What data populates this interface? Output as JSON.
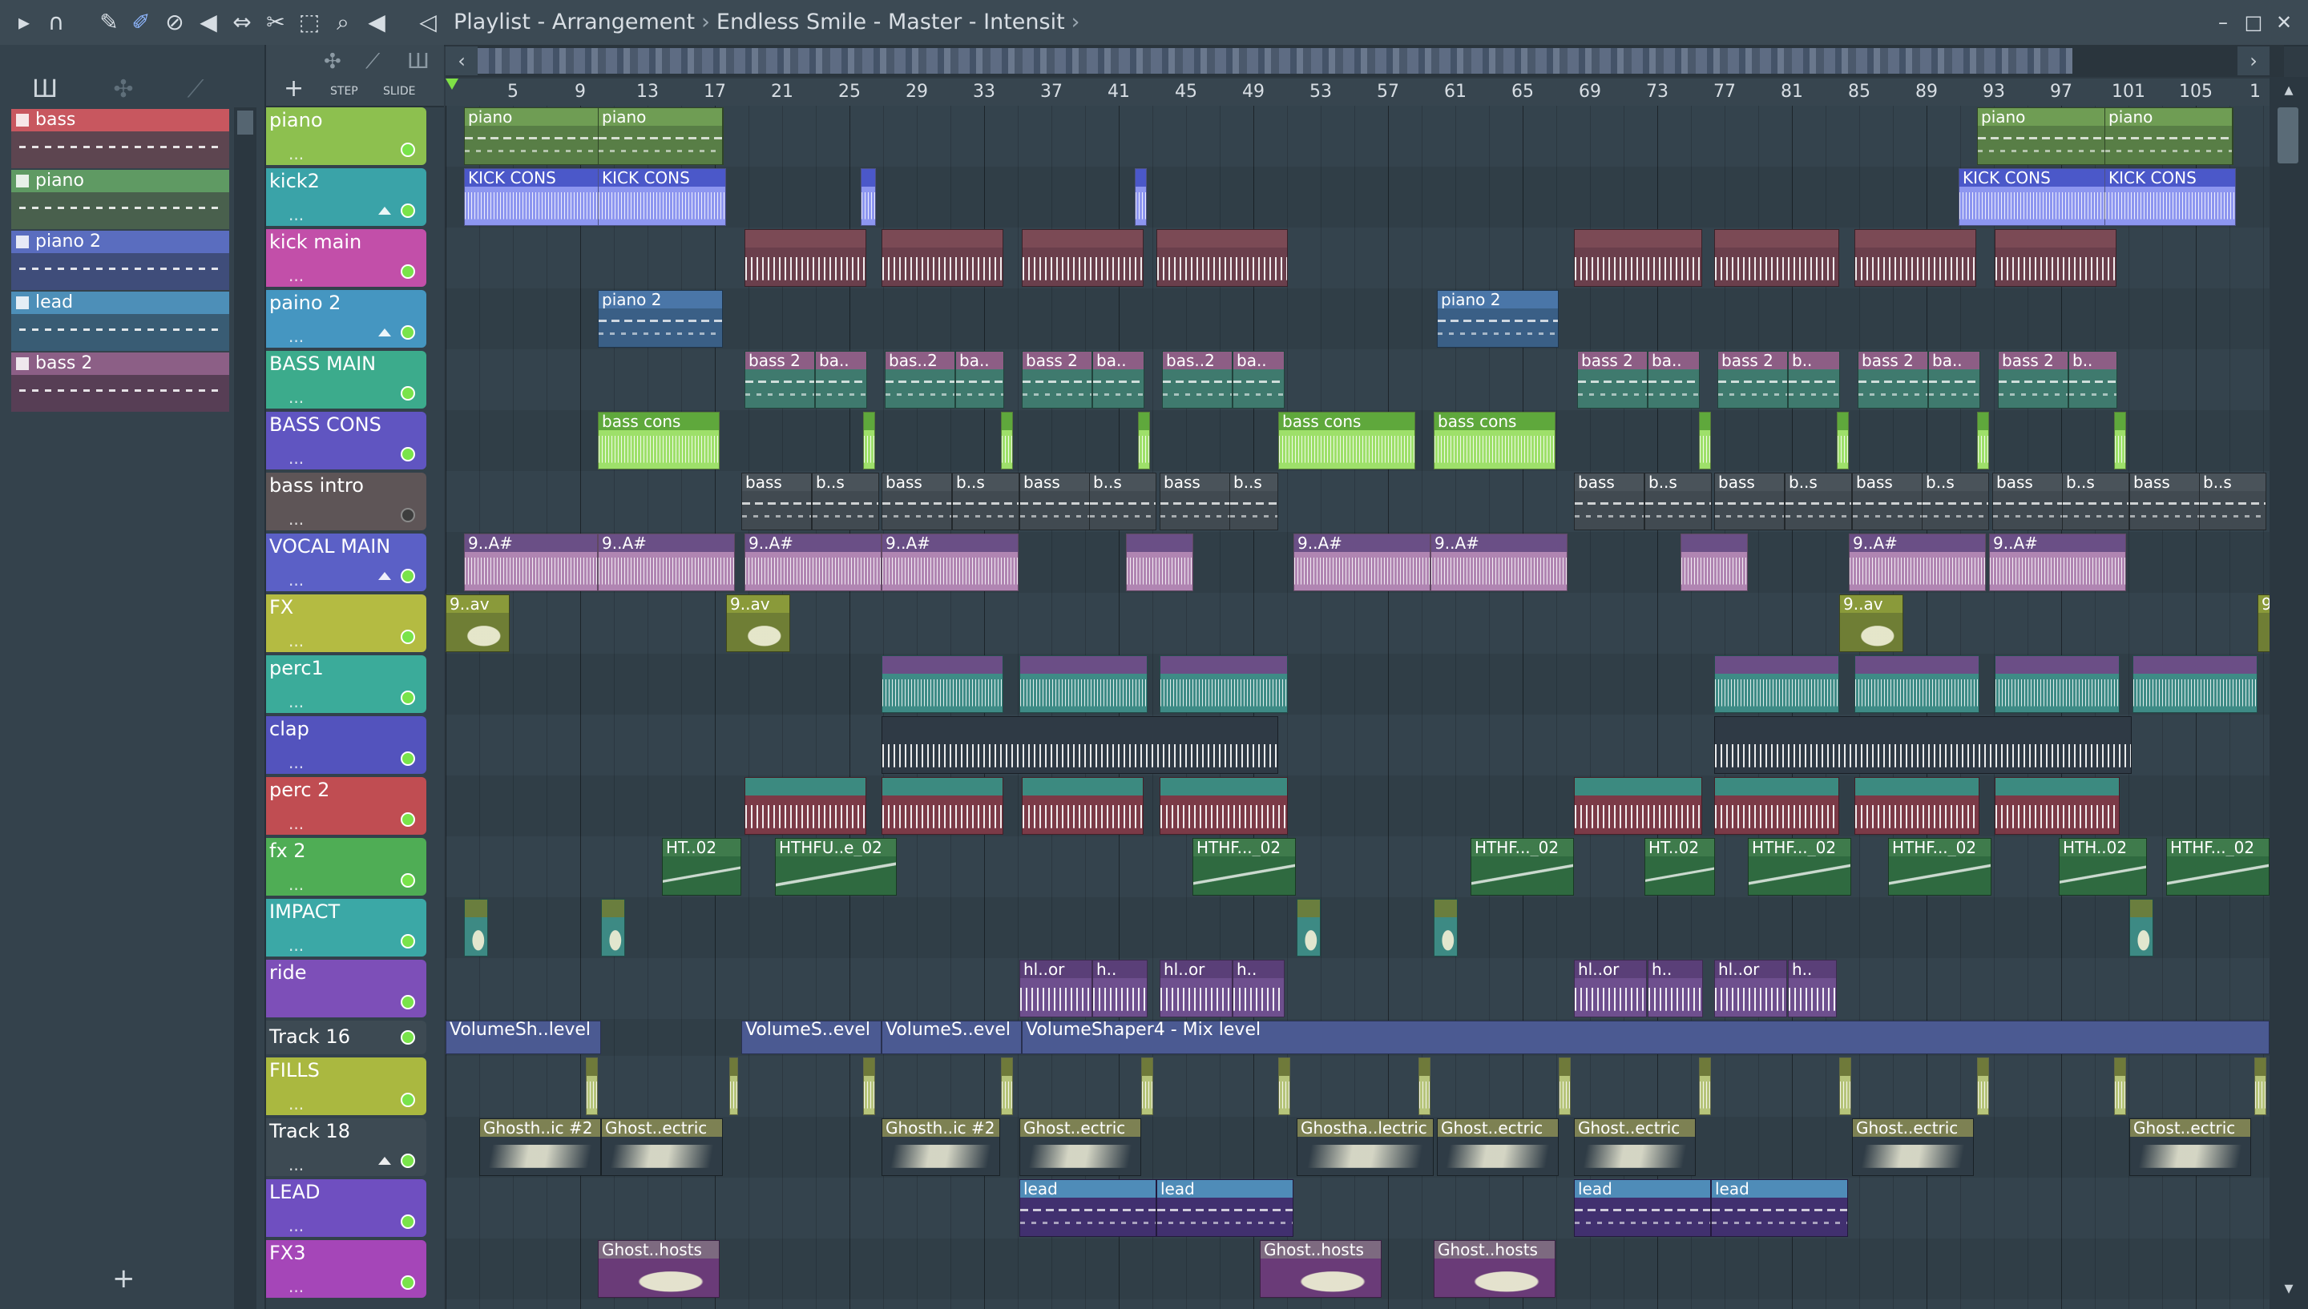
{
  "window": {
    "title_parts": [
      "Playlist - Arrangement",
      "Endless Smile - Master - Intensit"
    ],
    "buttons": [
      "minimize-icon",
      "maximize-icon",
      "close-icon"
    ]
  },
  "toolbar": {
    "icons": [
      "play-menu-icon",
      "magnet-snap-icon",
      "pencil-icon",
      "paint-brush-icon",
      "delete-icon",
      "mute-icon",
      "slip-icon",
      "slice-icon",
      "select-icon",
      "zoom-icon",
      "playback-icon",
      "speaker-icon"
    ]
  },
  "picker": {
    "tabs": [
      "piano-roll-icon",
      "automation-icon",
      "audio-icon"
    ],
    "items": [
      {
        "label": "bass",
        "color": "#c8575f"
      },
      {
        "label": "piano",
        "color": "#5f9a63"
      },
      {
        "label": "piano 2",
        "color": "#5a6dbf"
      },
      {
        "label": "lead",
        "color": "#4d8fb8"
      },
      {
        "label": "bass 2",
        "color": "#8c5f86"
      }
    ],
    "add_label": "+"
  },
  "header_tools": {
    "add_label": "+",
    "step_label": "STEP",
    "slide_label": "SLIDE"
  },
  "ruler": {
    "bars": [
      "5",
      "9",
      "13",
      "17",
      "21",
      "25",
      "29",
      "33",
      "37",
      "41",
      "45",
      "49",
      "53",
      "57",
      "61",
      "65",
      "69",
      "73",
      "77",
      "81",
      "85",
      "89",
      "93",
      "97",
      "101",
      "105",
      "1"
    ]
  },
  "tracks": [
    {
      "name": "piano",
      "color": "#8dc04f",
      "text": "#ffffff",
      "dots": "...",
      "arrow": false,
      "muted": false
    },
    {
      "name": "kick2",
      "color": "#3aa3a8",
      "dots": "...",
      "arrow": true,
      "muted": false
    },
    {
      "name": "kick main",
      "color": "#c24fa9",
      "dots": "...",
      "arrow": false,
      "muted": false
    },
    {
      "name": "paino 2",
      "color": "#4596c1",
      "dots": "...",
      "arrow": true,
      "muted": false
    },
    {
      "name": "BASS MAIN",
      "color": "#3cab8c",
      "dots": "...",
      "arrow": false,
      "muted": false
    },
    {
      "name": "BASS CONS",
      "color": "#6055c1",
      "dots": "...",
      "arrow": false,
      "muted": false
    },
    {
      "name": "bass intro",
      "color": "#5e5557",
      "dots": "...",
      "arrow": false,
      "muted": true
    },
    {
      "name": "VOCAL MAIN",
      "color": "#5b60c6",
      "dots": "...",
      "arrow": true,
      "muted": false
    },
    {
      "name": "FX",
      "color": "#b4bb42",
      "dots": "...",
      "arrow": false,
      "muted": false
    },
    {
      "name": "perc1",
      "color": "#3bab9a",
      "dots": "...",
      "arrow": false,
      "muted": false
    },
    {
      "name": "clap",
      "color": "#5353bd",
      "dots": "...",
      "arrow": false,
      "muted": false
    },
    {
      "name": "perc 2",
      "color": "#c04d52",
      "dots": "...",
      "arrow": false,
      "muted": false
    },
    {
      "name": "fx 2",
      "color": "#4fad55",
      "dots": "...",
      "arrow": false,
      "muted": false
    },
    {
      "name": "IMPACT",
      "color": "#3ba8a6",
      "dots": "...",
      "arrow": false,
      "muted": false
    },
    {
      "name": "ride",
      "color": "#7d4fb8",
      "dots": "",
      "arrow": false,
      "muted": false
    },
    {
      "name": "Track 16",
      "color": "#3d4a53",
      "dots": "",
      "arrow": false,
      "muted": false
    },
    {
      "name": "FILLS",
      "color": "#aab840",
      "dots": "...",
      "arrow": false,
      "muted": false
    },
    {
      "name": "Track 18",
      "color": "#3d4a53",
      "dots": "...",
      "arrow": true,
      "muted": false
    },
    {
      "name": "LEAD",
      "color": "#6f4fc0",
      "dots": "...",
      "arrow": false,
      "muted": false
    },
    {
      "name": "FX3",
      "color": "#a546b8",
      "dots": "...",
      "arrow": false,
      "muted": false
    }
  ],
  "clips": {
    "piano": "piano",
    "kick2": "KICK CONS",
    "piano2": "piano 2",
    "bass2": "bass 2",
    "bass2_ba": "ba..",
    "bass_dotdot": "bas..2",
    "bass2_b": "b..",
    "bass_cons": "bass cons",
    "bass_intro": "bass",
    "bass_intro_s": "b..s",
    "vocal": "9..A#",
    "fx": "9..av",
    "ht02": "HT..02",
    "hthfue02": "HTHFU..e_02",
    "hthf02": "HTHF..._02",
    "hth02": "HTH..02",
    "hlor": "hl..or",
    "h": "h..",
    "vol_short": "VolumeSh..level",
    "vol_s": "VolumeS..evel",
    "vol_full": "VolumeShaper4 - Mix level",
    "ghost_ic2": "Ghosth..ic #2",
    "ghost_ectric": "Ghost..ectric",
    "ghosth_lectric": "Ghostha..lectric",
    "lead": "lead",
    "ghost_hosts": "Ghost..hosts"
  }
}
